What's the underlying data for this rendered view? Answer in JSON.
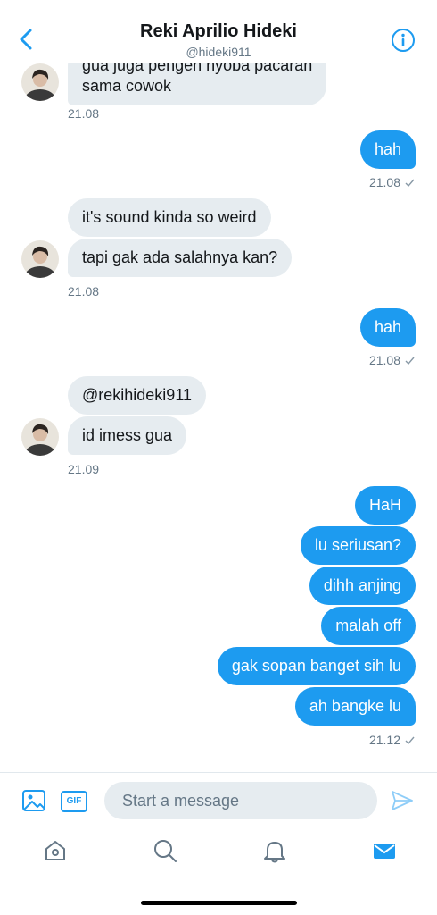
{
  "header": {
    "name": "Reki Aprilio Hideki",
    "handle": "@hideki911"
  },
  "messages": {
    "m1": "gua juga pengen nyoba pacaran\nsama cowok",
    "t1": "21.08",
    "m2": "hah",
    "t2": "21.08",
    "m3": "it's sound kinda so weird",
    "m4": "tapi gak ada salahnya kan?",
    "t3": "21.08",
    "m5": "hah",
    "t4": "21.08",
    "m6": "@rekihideki911",
    "m7": "id imess gua",
    "t5": "21.09",
    "m8": "HaH",
    "m9": "lu seriusan?",
    "m10": "dihh anjing",
    "m11": "malah off",
    "m12": "gak sopan banget sih lu",
    "m13": "ah bangke lu",
    "t6": "21.12"
  },
  "compose": {
    "placeholder": "Start a message",
    "gif_label": "GIF"
  },
  "icons": {
    "back": "chevron-left-icon",
    "info": "info-icon",
    "image": "image-icon",
    "gif": "gif-icon",
    "send": "send-icon",
    "home": "home-icon",
    "search": "search-icon",
    "notifications": "bell-icon",
    "messages": "mail-icon"
  },
  "colors": {
    "accent": "#1d9bf0",
    "incoming_bubble": "#e6ecf0",
    "muted_text": "#657786"
  }
}
